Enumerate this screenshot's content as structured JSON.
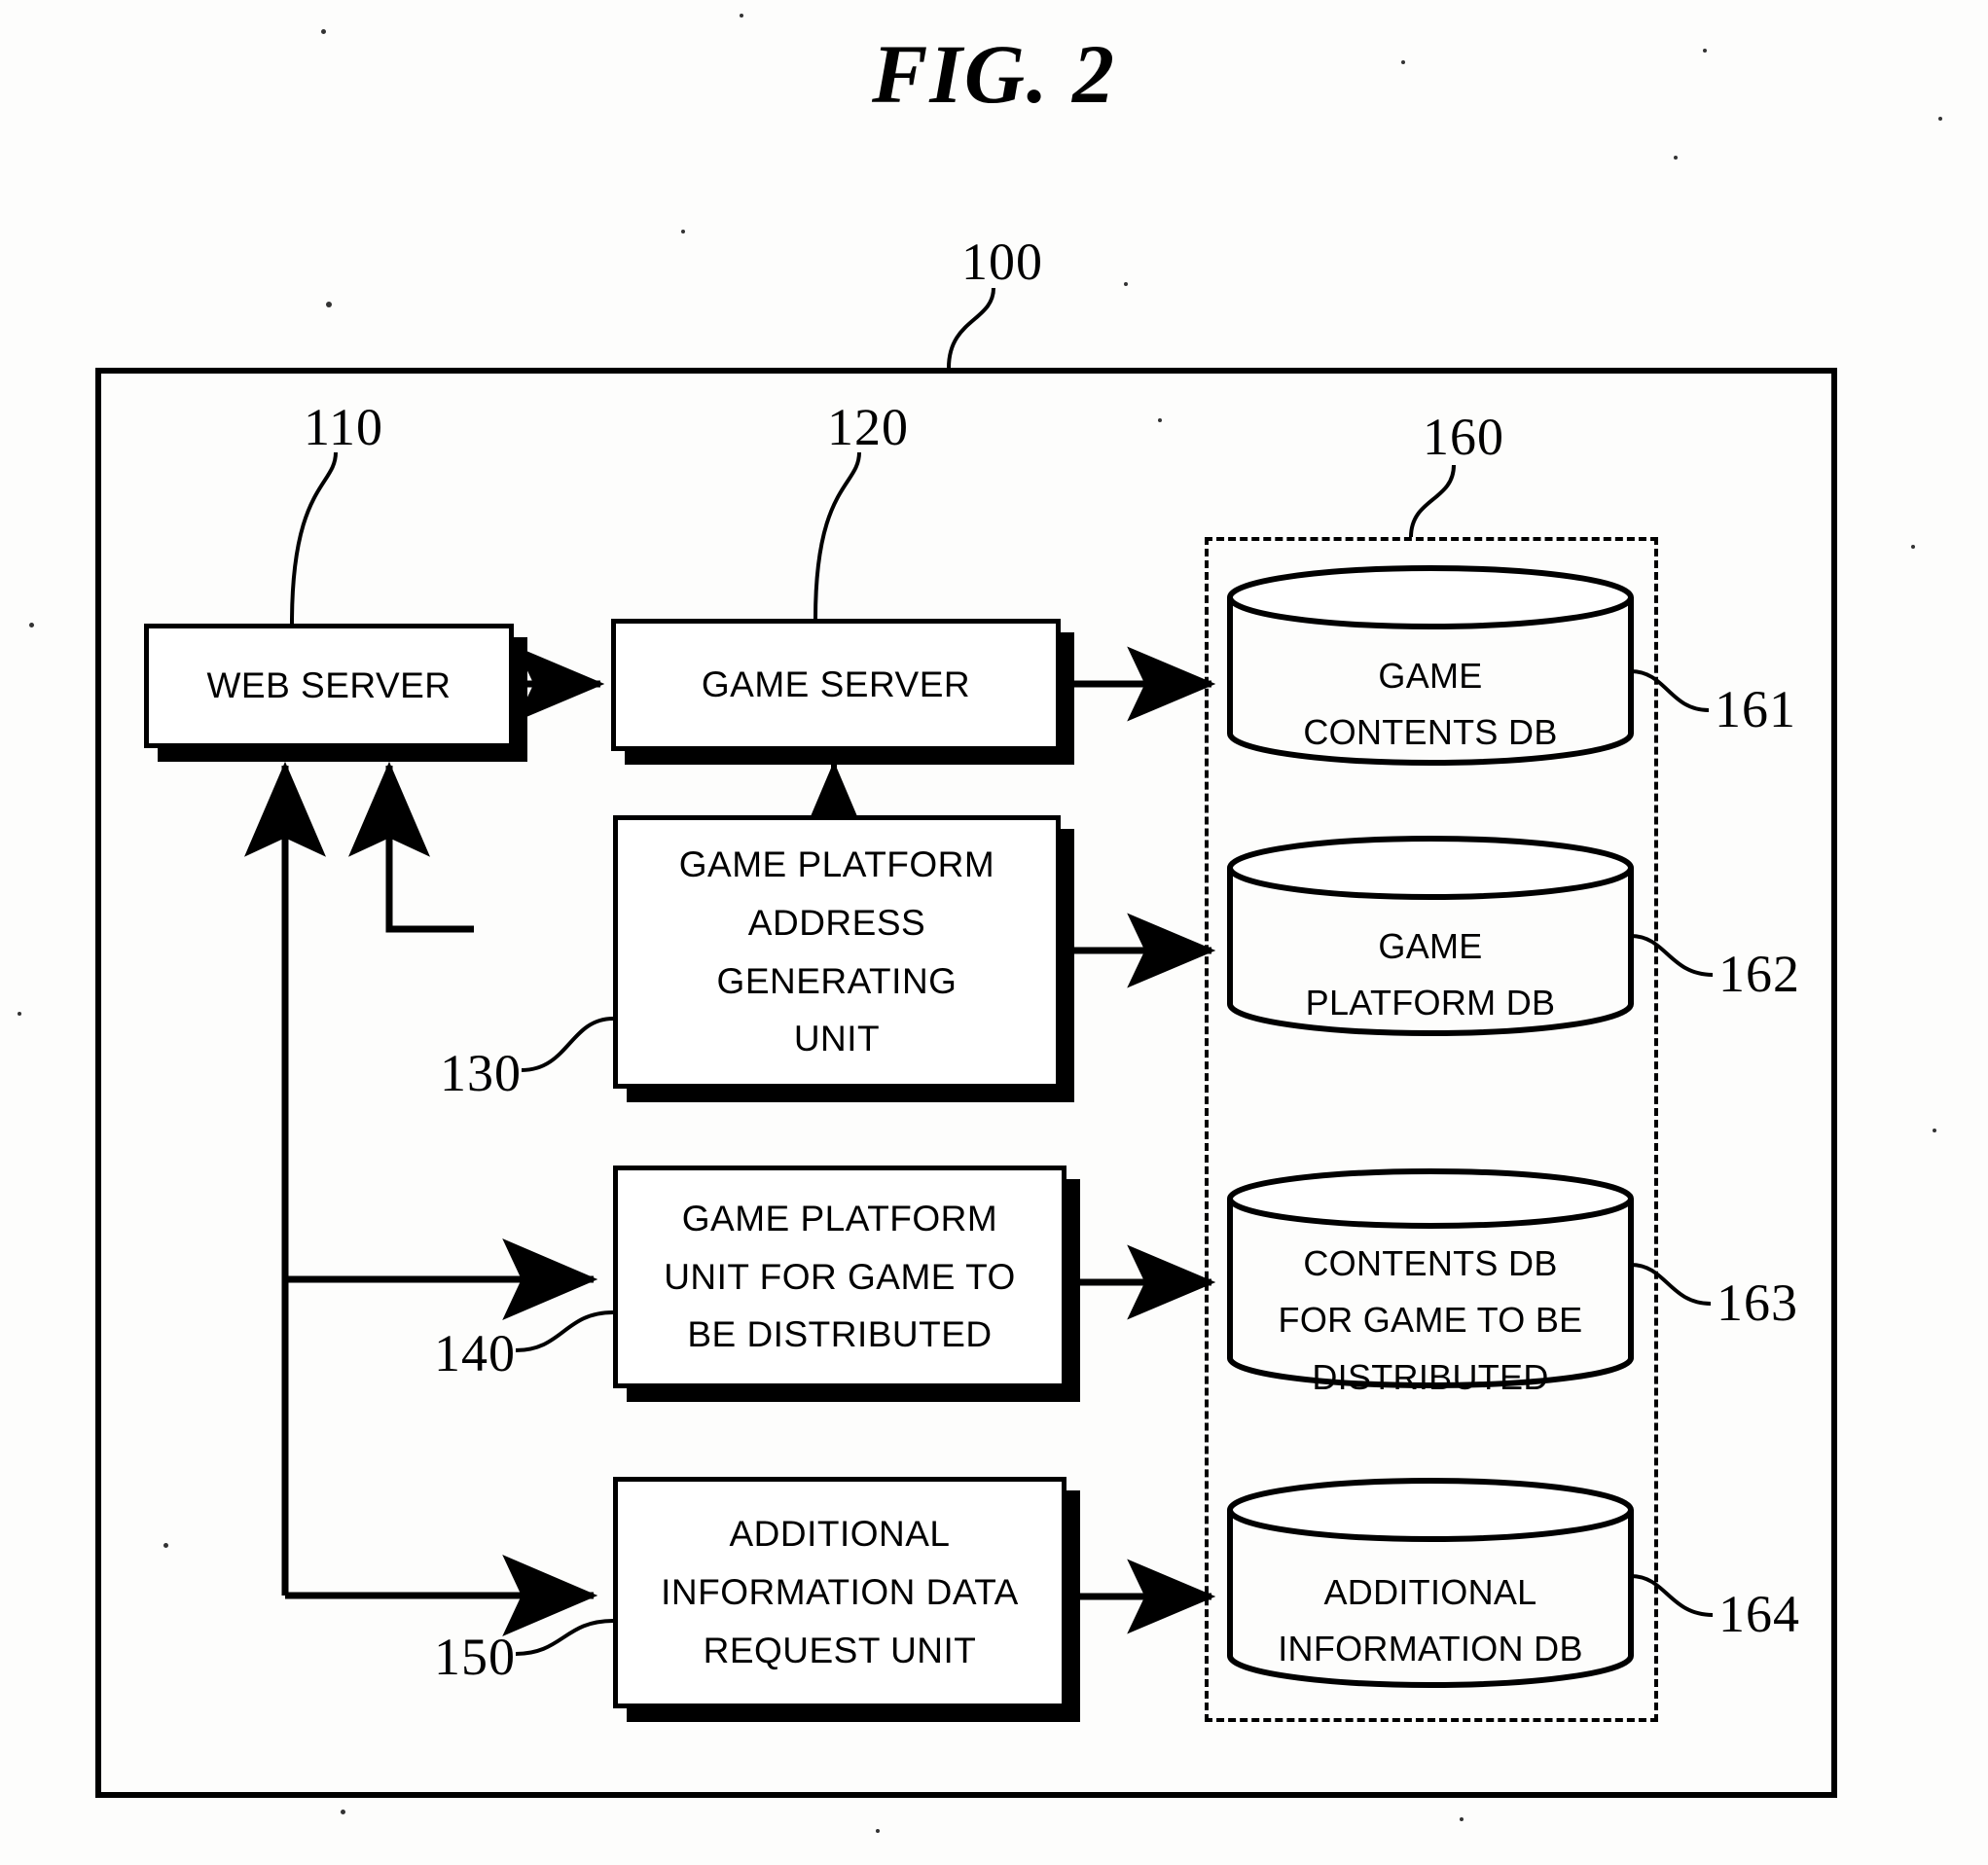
{
  "figure": {
    "title": "FIG. 2",
    "domain": "patent-block-diagram"
  },
  "system": {
    "ref": "100",
    "label": "system-boundary"
  },
  "blocks": [
    {
      "ref": "110",
      "lines": [
        "WEB SERVER"
      ],
      "name": "web-server"
    },
    {
      "ref": "120",
      "lines": [
        "GAME SERVER"
      ],
      "name": "game-server"
    },
    {
      "ref": "130",
      "lines": [
        "GAME PLATFORM",
        "ADDRESS",
        "GENERATING",
        "UNIT"
      ],
      "name": "game-platform-address-generating-unit"
    },
    {
      "ref": "140",
      "lines": [
        "GAME PLATFORM",
        "UNIT FOR GAME TO",
        "BE DISTRIBUTED"
      ],
      "name": "game-platform-unit-for-game-to-be-distributed"
    },
    {
      "ref": "150",
      "lines": [
        "ADDITIONAL",
        "INFORMATION DATA",
        "REQUEST UNIT"
      ],
      "name": "additional-information-data-request-unit"
    }
  ],
  "database_group": {
    "ref": "160",
    "name": "database-group"
  },
  "databases": [
    {
      "ref": "161",
      "lines": [
        "GAME",
        "CONTENTS DB"
      ],
      "name": "game-contents-db"
    },
    {
      "ref": "162",
      "lines": [
        "GAME",
        "PLATFORM DB"
      ],
      "name": "game-platform-db"
    },
    {
      "ref": "163",
      "lines": [
        "CONTENTS DB",
        "FOR GAME TO BE",
        "DISTRIBUTED"
      ],
      "name": "contents-db-for-game-to-be-distributed"
    },
    {
      "ref": "164",
      "lines": [
        "ADDITIONAL",
        "INFORMATION DB"
      ],
      "name": "additional-information-db"
    }
  ],
  "colors": {
    "ink": "#000000",
    "paper": "#fdfdfc"
  }
}
